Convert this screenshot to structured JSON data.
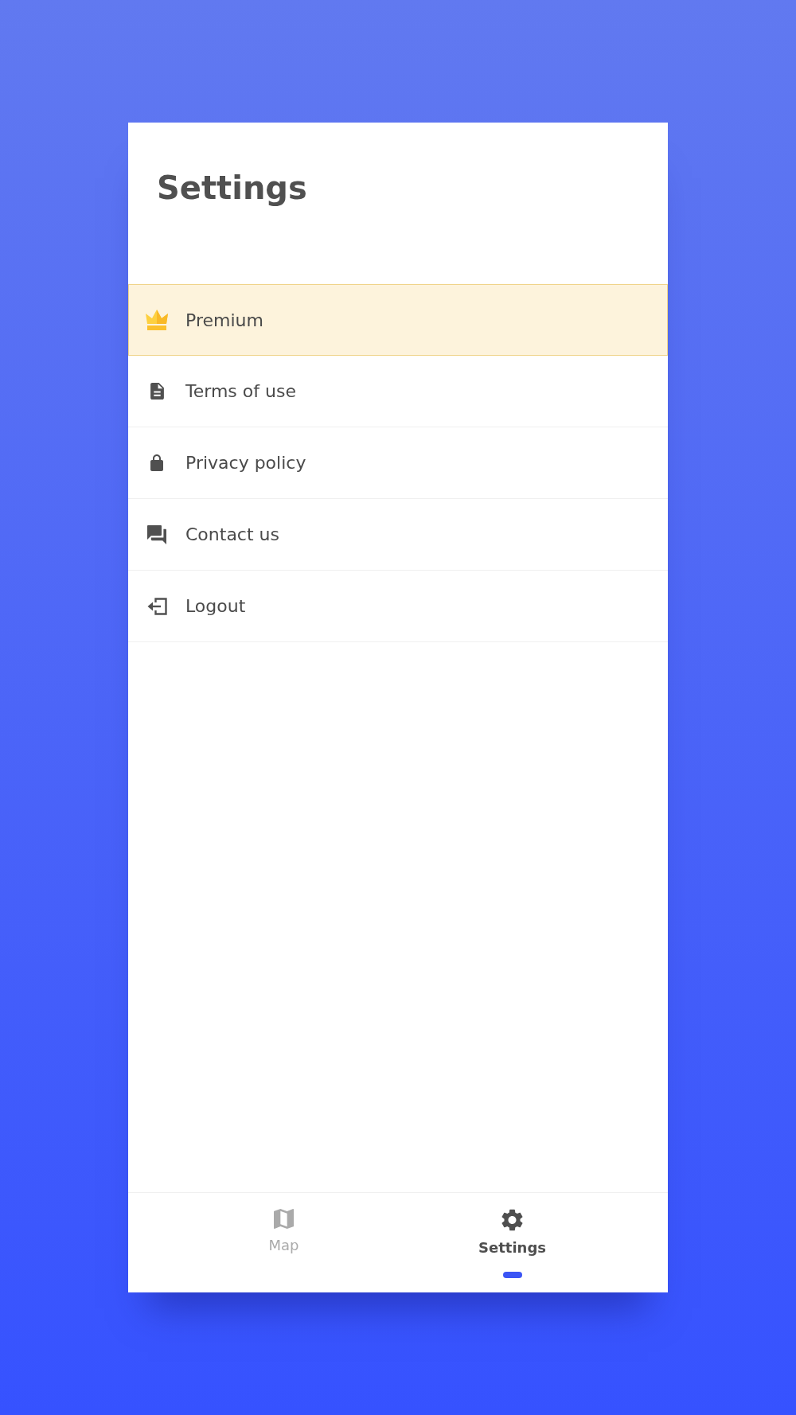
{
  "header": {
    "title": "Settings"
  },
  "menu": {
    "items": [
      {
        "label": "Premium",
        "highlighted": true
      },
      {
        "label": "Terms of use",
        "highlighted": false
      },
      {
        "label": "Privacy policy",
        "highlighted": false
      },
      {
        "label": "Contact us",
        "highlighted": false
      },
      {
        "label": "Logout",
        "highlighted": false
      }
    ]
  },
  "nav": {
    "tabs": [
      {
        "label": "Map",
        "selected": false
      },
      {
        "label": "Settings",
        "selected": true
      }
    ]
  }
}
